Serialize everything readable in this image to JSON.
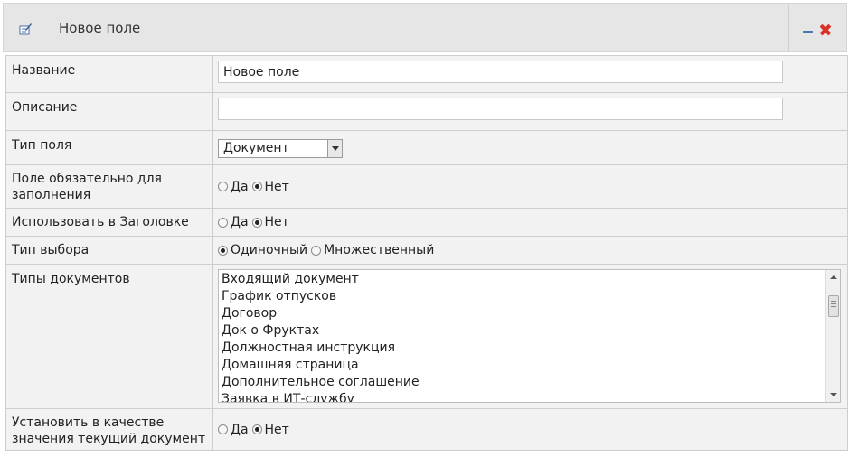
{
  "dialog": {
    "title": "Новое поле",
    "icon": "edit-field-icon",
    "minimize_icon": "minimize-icon",
    "close_icon": "close-icon",
    "close_glyph": "✖"
  },
  "form": {
    "name": {
      "label": "Название",
      "value": "Новое поле"
    },
    "description": {
      "label": "Описание",
      "value": ""
    },
    "field_type": {
      "label": "Тип поля",
      "selected": "Документ"
    },
    "required": {
      "label": "Поле обязательно для заполнения",
      "yes": "Да",
      "no": "Нет",
      "selected": "no"
    },
    "use_in_title": {
      "label": "Использовать в Заголовке",
      "yes": "Да",
      "no": "Нет",
      "selected": "no"
    },
    "selection_type": {
      "label": "Тип выбора",
      "single": "Одиночный",
      "multiple": "Множественный",
      "selected": "single"
    },
    "doc_types": {
      "label": "Типы документов",
      "items": [
        "Входящий документ",
        "График отпусков",
        "Договор",
        "Док о Фруктах",
        "Должностная инструкция",
        "Домашняя страница",
        "Дополнительное соглашение",
        "Заявка в ИТ-службу"
      ]
    },
    "set_current": {
      "label": "Установить в качестве значения текущий документ",
      "yes": "Да",
      "no": "Нет",
      "selected": "no"
    }
  },
  "colors": {
    "titlebar_bg": "#e6e6e6",
    "row_bg": "#f2f2f2",
    "close_red": "#d9312a",
    "minimize_blue": "#4a79b6"
  }
}
